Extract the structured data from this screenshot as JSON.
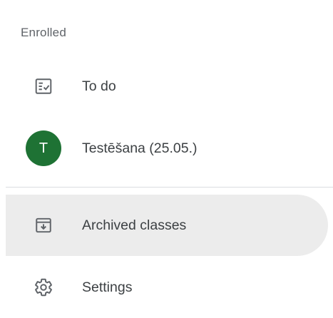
{
  "nav": {
    "section_label": "Enrolled",
    "todo": {
      "label": "To do",
      "icon": "todo-list-icon"
    },
    "class": {
      "label": "Testēšana (25.05.)",
      "avatar_letter": "T",
      "avatar_color": "#1e7234"
    },
    "archived": {
      "label": "Archived classes",
      "icon": "archive-icon",
      "selected": true
    },
    "settings": {
      "label": "Settings",
      "icon": "gear-icon"
    }
  },
  "colors": {
    "selected_bg": "#ececec",
    "icon": "#5f6368",
    "text": "#3c4043",
    "divider": "#dadce0"
  }
}
